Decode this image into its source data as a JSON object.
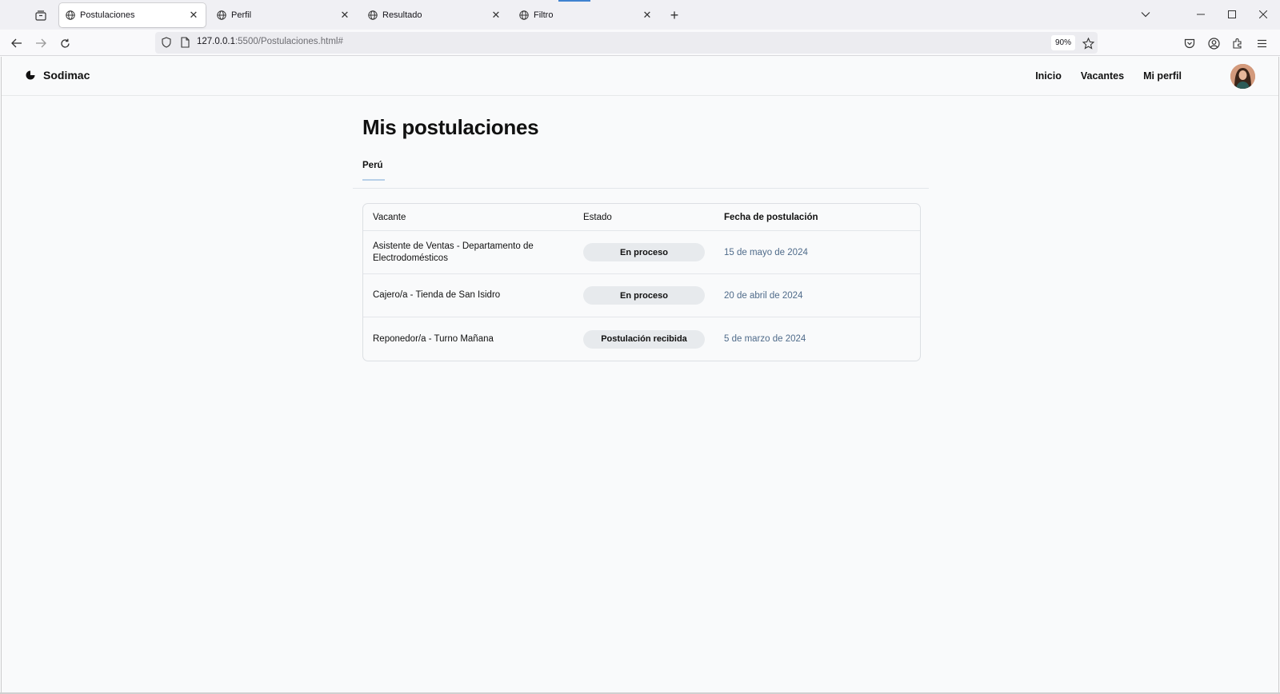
{
  "browser": {
    "tabs": [
      {
        "title": "Postulaciones",
        "active": true
      },
      {
        "title": "Perfil",
        "active": false
      },
      {
        "title": "Resultado",
        "active": false
      },
      {
        "title": "Filtro",
        "active": false
      }
    ],
    "url_host": "127.0.0.1",
    "url_rest": ":5500/Postulaciones.html#",
    "zoom": "90%"
  },
  "site": {
    "brand": "Sodimac",
    "nav": [
      "Inicio",
      "Vacantes",
      "Mi perfil"
    ]
  },
  "main": {
    "title": "Mis postulaciones",
    "country_tab": "Perú",
    "table": {
      "headers": [
        "Vacante",
        "Estado",
        "Fecha de postulación"
      ],
      "rows": [
        {
          "vacante": "Asistente de Ventas - Departamento de Electrodomésticos",
          "estado": "En proceso",
          "fecha": "15 de mayo de 2024"
        },
        {
          "vacante": "Cajero/a - Tienda de San Isidro",
          "estado": "En proceso",
          "fecha": "20 de abril de 2024"
        },
        {
          "vacante": "Reponedor/a - Turno Mañana",
          "estado": "Postulación recibida",
          "fecha": "5 de marzo de 2024"
        }
      ]
    }
  },
  "colors": {
    "date_text": "#4f6b8a",
    "pill_bg": "#e7eaed",
    "tab_underline": "#b7d0e8"
  }
}
